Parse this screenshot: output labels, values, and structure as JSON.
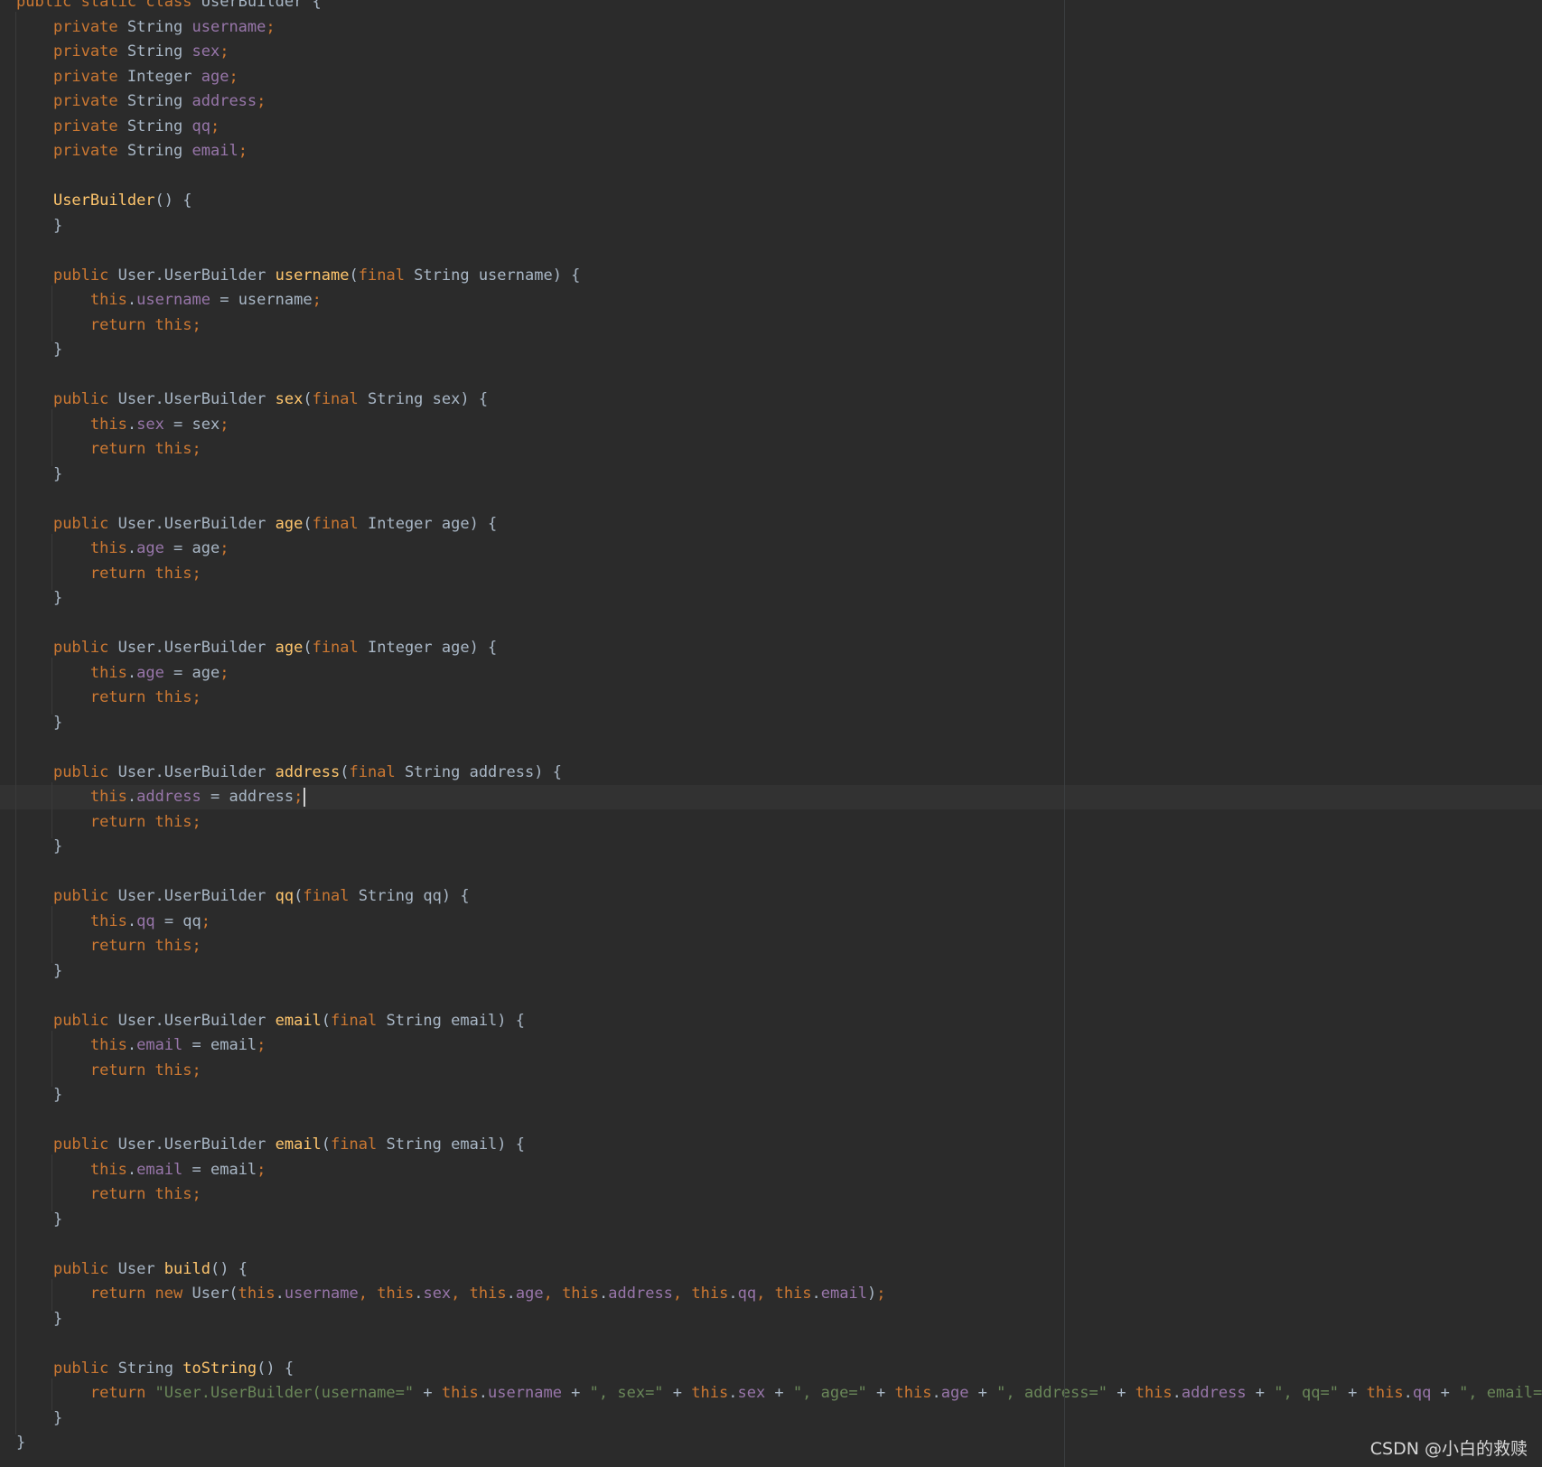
{
  "theme": {
    "background": "#2b2b2b",
    "caret_row": "#323232",
    "default": "#a9b7c6",
    "keyword": "#cc7832",
    "field": "#9876aa",
    "method": "#ffc66d",
    "string": "#6a8759",
    "punct": "#cc7832"
  },
  "editor": {
    "caret_line_index": 32,
    "lines": [
      [
        [
          "keyword",
          "public "
        ],
        [
          "keyword",
          "static "
        ],
        [
          "keyword",
          "class "
        ],
        [
          "default",
          "UserBuilder {"
        ]
      ],
      [
        [
          "default",
          "    "
        ],
        [
          "keyword",
          "private "
        ],
        [
          "default",
          "String "
        ],
        [
          "field",
          "username"
        ],
        [
          "punct",
          ";"
        ]
      ],
      [
        [
          "default",
          "    "
        ],
        [
          "keyword",
          "private "
        ],
        [
          "default",
          "String "
        ],
        [
          "field",
          "sex"
        ],
        [
          "punct",
          ";"
        ]
      ],
      [
        [
          "default",
          "    "
        ],
        [
          "keyword",
          "private "
        ],
        [
          "default",
          "Integer "
        ],
        [
          "field",
          "age"
        ],
        [
          "punct",
          ";"
        ]
      ],
      [
        [
          "default",
          "    "
        ],
        [
          "keyword",
          "private "
        ],
        [
          "default",
          "String "
        ],
        [
          "field",
          "address"
        ],
        [
          "punct",
          ";"
        ]
      ],
      [
        [
          "default",
          "    "
        ],
        [
          "keyword",
          "private "
        ],
        [
          "default",
          "String "
        ],
        [
          "field",
          "qq"
        ],
        [
          "punct",
          ";"
        ]
      ],
      [
        [
          "default",
          "    "
        ],
        [
          "keyword",
          "private "
        ],
        [
          "default",
          "String "
        ],
        [
          "field",
          "email"
        ],
        [
          "punct",
          ";"
        ]
      ],
      [],
      [
        [
          "default",
          "    "
        ],
        [
          "method",
          "UserBuilder"
        ],
        [
          "default",
          "() {"
        ]
      ],
      [
        [
          "default",
          "    }"
        ]
      ],
      [],
      [
        [
          "default",
          "    "
        ],
        [
          "keyword",
          "public "
        ],
        [
          "default",
          "User.UserBuilder "
        ],
        [
          "method",
          "username"
        ],
        [
          "default",
          "("
        ],
        [
          "keyword",
          "final "
        ],
        [
          "default",
          "String username) {"
        ]
      ],
      [
        [
          "default",
          "        "
        ],
        [
          "keyword",
          "this"
        ],
        [
          "default",
          "."
        ],
        [
          "field",
          "username"
        ],
        [
          "default",
          " = username"
        ],
        [
          "punct",
          ";"
        ]
      ],
      [
        [
          "default",
          "        "
        ],
        [
          "keyword",
          "return this;"
        ]
      ],
      [
        [
          "default",
          "    }"
        ]
      ],
      [],
      [
        [
          "default",
          "    "
        ],
        [
          "keyword",
          "public "
        ],
        [
          "default",
          "User.UserBuilder "
        ],
        [
          "method",
          "sex"
        ],
        [
          "default",
          "("
        ],
        [
          "keyword",
          "final "
        ],
        [
          "default",
          "String sex) {"
        ]
      ],
      [
        [
          "default",
          "        "
        ],
        [
          "keyword",
          "this"
        ],
        [
          "default",
          "."
        ],
        [
          "field",
          "sex"
        ],
        [
          "default",
          " = sex"
        ],
        [
          "punct",
          ";"
        ]
      ],
      [
        [
          "default",
          "        "
        ],
        [
          "keyword",
          "return this;"
        ]
      ],
      [
        [
          "default",
          "    }"
        ]
      ],
      [],
      [
        [
          "default",
          "    "
        ],
        [
          "keyword",
          "public "
        ],
        [
          "default",
          "User.UserBuilder "
        ],
        [
          "method",
          "age"
        ],
        [
          "default",
          "("
        ],
        [
          "keyword",
          "final "
        ],
        [
          "default",
          "Integer age) {"
        ]
      ],
      [
        [
          "default",
          "        "
        ],
        [
          "keyword",
          "this"
        ],
        [
          "default",
          "."
        ],
        [
          "field",
          "age"
        ],
        [
          "default",
          " = age"
        ],
        [
          "punct",
          ";"
        ]
      ],
      [
        [
          "default",
          "        "
        ],
        [
          "keyword",
          "return this;"
        ]
      ],
      [
        [
          "default",
          "    }"
        ]
      ],
      [],
      [
        [
          "default",
          "    "
        ],
        [
          "keyword",
          "public "
        ],
        [
          "default",
          "User.UserBuilder "
        ],
        [
          "method",
          "age"
        ],
        [
          "default",
          "("
        ],
        [
          "keyword",
          "final "
        ],
        [
          "default",
          "Integer age) {"
        ]
      ],
      [
        [
          "default",
          "        "
        ],
        [
          "keyword",
          "this"
        ],
        [
          "default",
          "."
        ],
        [
          "field",
          "age"
        ],
        [
          "default",
          " = age"
        ],
        [
          "punct",
          ";"
        ]
      ],
      [
        [
          "default",
          "        "
        ],
        [
          "keyword",
          "return this;"
        ]
      ],
      [
        [
          "default",
          "    }"
        ]
      ],
      [],
      [
        [
          "default",
          "    "
        ],
        [
          "keyword",
          "public "
        ],
        [
          "default",
          "User.UserBuilder "
        ],
        [
          "method",
          "address"
        ],
        [
          "default",
          "("
        ],
        [
          "keyword",
          "final "
        ],
        [
          "default",
          "String address) {"
        ]
      ],
      [
        [
          "default",
          "        "
        ],
        [
          "keyword",
          "this"
        ],
        [
          "default",
          "."
        ],
        [
          "field",
          "address"
        ],
        [
          "default",
          " = address"
        ],
        [
          "punct",
          ";"
        ]
      ],
      [
        [
          "default",
          "        "
        ],
        [
          "keyword",
          "return this;"
        ]
      ],
      [
        [
          "default",
          "    }"
        ]
      ],
      [],
      [
        [
          "default",
          "    "
        ],
        [
          "keyword",
          "public "
        ],
        [
          "default",
          "User.UserBuilder "
        ],
        [
          "method",
          "qq"
        ],
        [
          "default",
          "("
        ],
        [
          "keyword",
          "final "
        ],
        [
          "default",
          "String qq) {"
        ]
      ],
      [
        [
          "default",
          "        "
        ],
        [
          "keyword",
          "this"
        ],
        [
          "default",
          "."
        ],
        [
          "field",
          "qq"
        ],
        [
          "default",
          " = qq"
        ],
        [
          "punct",
          ";"
        ]
      ],
      [
        [
          "default",
          "        "
        ],
        [
          "keyword",
          "return this;"
        ]
      ],
      [
        [
          "default",
          "    }"
        ]
      ],
      [],
      [
        [
          "default",
          "    "
        ],
        [
          "keyword",
          "public "
        ],
        [
          "default",
          "User.UserBuilder "
        ],
        [
          "method",
          "email"
        ],
        [
          "default",
          "("
        ],
        [
          "keyword",
          "final "
        ],
        [
          "default",
          "String email) {"
        ]
      ],
      [
        [
          "default",
          "        "
        ],
        [
          "keyword",
          "this"
        ],
        [
          "default",
          "."
        ],
        [
          "field",
          "email"
        ],
        [
          "default",
          " = email"
        ],
        [
          "punct",
          ";"
        ]
      ],
      [
        [
          "default",
          "        "
        ],
        [
          "keyword",
          "return this;"
        ]
      ],
      [
        [
          "default",
          "    }"
        ]
      ],
      [],
      [
        [
          "default",
          "    "
        ],
        [
          "keyword",
          "public "
        ],
        [
          "default",
          "User.UserBuilder "
        ],
        [
          "method",
          "email"
        ],
        [
          "default",
          "("
        ],
        [
          "keyword",
          "final "
        ],
        [
          "default",
          "String email) {"
        ]
      ],
      [
        [
          "default",
          "        "
        ],
        [
          "keyword",
          "this"
        ],
        [
          "default",
          "."
        ],
        [
          "field",
          "email"
        ],
        [
          "default",
          " = email"
        ],
        [
          "punct",
          ";"
        ]
      ],
      [
        [
          "default",
          "        "
        ],
        [
          "keyword",
          "return this;"
        ]
      ],
      [
        [
          "default",
          "    }"
        ]
      ],
      [],
      [
        [
          "default",
          "    "
        ],
        [
          "keyword",
          "public "
        ],
        [
          "default",
          "User "
        ],
        [
          "method",
          "build"
        ],
        [
          "default",
          "() {"
        ]
      ],
      [
        [
          "default",
          "        "
        ],
        [
          "keyword",
          "return new "
        ],
        [
          "default",
          "User("
        ],
        [
          "keyword",
          "this"
        ],
        [
          "default",
          "."
        ],
        [
          "field",
          "username"
        ],
        [
          "punct",
          ", "
        ],
        [
          "keyword",
          "this"
        ],
        [
          "default",
          "."
        ],
        [
          "field",
          "sex"
        ],
        [
          "punct",
          ", "
        ],
        [
          "keyword",
          "this"
        ],
        [
          "default",
          "."
        ],
        [
          "field",
          "age"
        ],
        [
          "punct",
          ", "
        ],
        [
          "keyword",
          "this"
        ],
        [
          "default",
          "."
        ],
        [
          "field",
          "address"
        ],
        [
          "punct",
          ", "
        ],
        [
          "keyword",
          "this"
        ],
        [
          "default",
          "."
        ],
        [
          "field",
          "qq"
        ],
        [
          "punct",
          ", "
        ],
        [
          "keyword",
          "this"
        ],
        [
          "default",
          "."
        ],
        [
          "field",
          "email"
        ],
        [
          "default",
          ")"
        ],
        [
          "punct",
          ";"
        ]
      ],
      [
        [
          "default",
          "    }"
        ]
      ],
      [],
      [
        [
          "default",
          "    "
        ],
        [
          "keyword",
          "public "
        ],
        [
          "default",
          "String "
        ],
        [
          "method",
          "toString"
        ],
        [
          "default",
          "() {"
        ]
      ],
      [
        [
          "default",
          "        "
        ],
        [
          "keyword",
          "return "
        ],
        [
          "string",
          "\"User.UserBuilder(username=\""
        ],
        [
          "default",
          " + "
        ],
        [
          "keyword",
          "this"
        ],
        [
          "default",
          "."
        ],
        [
          "field",
          "username"
        ],
        [
          "default",
          " + "
        ],
        [
          "string",
          "\", sex=\""
        ],
        [
          "default",
          " + "
        ],
        [
          "keyword",
          "this"
        ],
        [
          "default",
          "."
        ],
        [
          "field",
          "sex"
        ],
        [
          "default",
          " + "
        ],
        [
          "string",
          "\", age=\""
        ],
        [
          "default",
          " + "
        ],
        [
          "keyword",
          "this"
        ],
        [
          "default",
          "."
        ],
        [
          "field",
          "age"
        ],
        [
          "default",
          " + "
        ],
        [
          "string",
          "\", address=\""
        ],
        [
          "default",
          " + "
        ],
        [
          "keyword",
          "this"
        ],
        [
          "default",
          "."
        ],
        [
          "field",
          "address"
        ],
        [
          "default",
          " + "
        ],
        [
          "string",
          "\", qq=\""
        ],
        [
          "default",
          " + "
        ],
        [
          "keyword",
          "this"
        ],
        [
          "default",
          "."
        ],
        [
          "field",
          "qq"
        ],
        [
          "default",
          " + "
        ],
        [
          "string",
          "\", email=\""
        ],
        [
          "default",
          " +"
        ]
      ],
      [
        [
          "default",
          "    }"
        ]
      ],
      [
        [
          "default",
          "}"
        ]
      ]
    ]
  },
  "watermark": {
    "text": "CSDN @小白的救赎"
  }
}
